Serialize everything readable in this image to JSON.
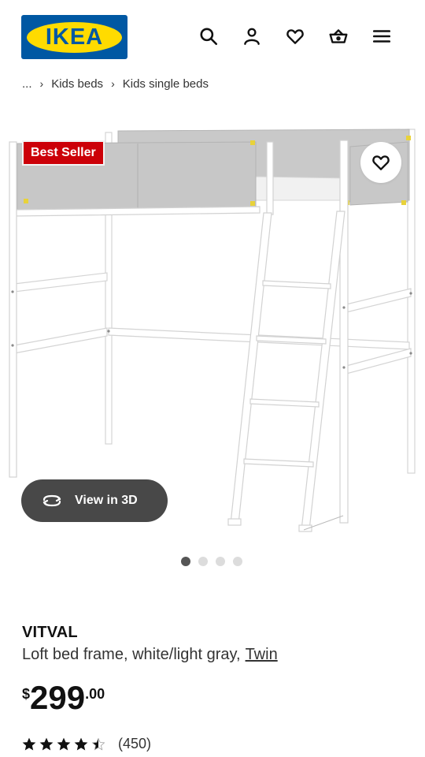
{
  "header": {
    "logo_text": "IKEA",
    "icons": [
      "search-icon",
      "account-icon",
      "heart-icon",
      "basket-icon",
      "menu-icon"
    ]
  },
  "breadcrumb": {
    "ellipsis": "...",
    "items": [
      "Kids beds",
      "Kids single beds"
    ]
  },
  "gallery": {
    "badge": "Best Seller",
    "view_3d_label": "View in 3D",
    "dots_total": 4,
    "active_dot": 1
  },
  "product": {
    "name": "VITVAL",
    "description": "Loft bed frame, white/light gray,",
    "size": "Twin",
    "currency": "$",
    "price_int": "299",
    "price_dec": ".00",
    "rating": 4.5,
    "review_count": "(450)"
  },
  "colors": {
    "ikea_blue": "#0058a3",
    "ikea_yellow": "#ffdb00",
    "badge_red": "#cc0008",
    "button_dark": "#484848"
  }
}
